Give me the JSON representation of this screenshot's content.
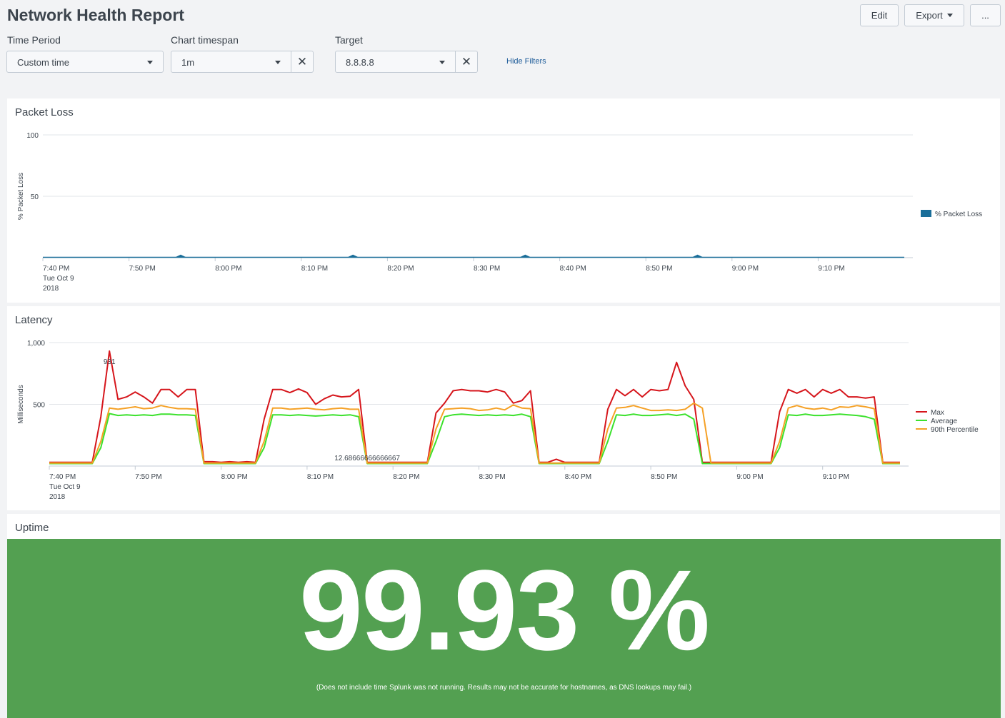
{
  "header": {
    "title": "Network Health Report",
    "edit_label": "Edit",
    "export_label": "Export",
    "more_label": "..."
  },
  "filters": {
    "time_period": {
      "label": "Time Period",
      "value": "Custom time"
    },
    "chart_timespan": {
      "label": "Chart timespan",
      "value": "1m"
    },
    "target": {
      "label": "Target",
      "value": "8.8.8.8"
    },
    "hide_filters": "Hide Filters",
    "clear_icon": "close-icon"
  },
  "panels": {
    "packet_loss": {
      "title": "Packet Loss",
      "chart_data": {
        "type": "area",
        "ylabel": "% Packet Loss",
        "ylim": [
          0,
          100
        ],
        "y_ticks": [
          "100",
          "50"
        ],
        "x_ticks": [
          "7:40 PM",
          "7:50 PM",
          "8:00 PM",
          "8:10 PM",
          "8:20 PM",
          "8:30 PM",
          "8:40 PM",
          "8:50 PM",
          "9:00 PM",
          "9:10 PM"
        ],
        "x_start_label": [
          "7:40 PM",
          "Tue Oct 9",
          "2018"
        ],
        "legend": [
          {
            "name": "% Packet Loss",
            "color": "#1a6e99"
          }
        ],
        "spike_minutes": [
          16,
          36,
          56,
          76
        ],
        "spike_value": 2.5,
        "x_domain_minutes": [
          0,
          100
        ],
        "baseline_value": 0.3
      }
    },
    "latency": {
      "title": "Latency",
      "chart_data": {
        "type": "line",
        "ylabel": "Milliseconds",
        "ylim": [
          0,
          1000
        ],
        "y_ticks": [
          "1,000",
          "500"
        ],
        "x_ticks": [
          "7:40 PM",
          "7:50 PM",
          "8:00 PM",
          "8:10 PM",
          "8:20 PM",
          "8:30 PM",
          "8:40 PM",
          "8:50 PM",
          "9:00 PM",
          "9:10 PM"
        ],
        "x_start_label": [
          "7:40 PM",
          "Tue Oct 9",
          "2018"
        ],
        "x_minutes": [
          0,
          5,
          6,
          7,
          8,
          9,
          10,
          11,
          12,
          13,
          14,
          15,
          16,
          17,
          18,
          19,
          20,
          21,
          22,
          23,
          24,
          25,
          26,
          27,
          28,
          29,
          30,
          31,
          32,
          33,
          34,
          35,
          36,
          37,
          38,
          39,
          40,
          41,
          42,
          43,
          44,
          45,
          46,
          47,
          48,
          49,
          50,
          51,
          52,
          53,
          54,
          55,
          56,
          57,
          58,
          59,
          60,
          61,
          62,
          63,
          64,
          65,
          66,
          67,
          68,
          69,
          70,
          71,
          72,
          73,
          74,
          75,
          76,
          77,
          78,
          79,
          80,
          81,
          82,
          83,
          84,
          85,
          86,
          87,
          88,
          89,
          90,
          91,
          92,
          93,
          94,
          95,
          96,
          97,
          98,
          99,
          100
        ],
        "annotations": [
          {
            "x_minute": 7,
            "text": "931"
          },
          {
            "x_minute": 37,
            "text": "12.68666666666667"
          }
        ],
        "series": [
          {
            "name": "Max",
            "color": "#d6161c",
            "values": [
              30,
              30,
              400,
              931,
              540,
              560,
              600,
              560,
              510,
              620,
              620,
              560,
              620,
              620,
              35,
              35,
              30,
              35,
              30,
              35,
              30,
              380,
              620,
              620,
              595,
              625,
              595,
              500,
              545,
              575,
              560,
              565,
              620,
              30,
              30,
              30,
              30,
              30,
              30,
              30,
              30,
              430,
              510,
              610,
              620,
              610,
              610,
              600,
              620,
              600,
              510,
              530,
              610,
              30,
              30,
              55,
              30,
              30,
              30,
              30,
              30,
              460,
              620,
              570,
              620,
              560,
              620,
              610,
              620,
              840,
              650,
              540,
              30,
              30,
              30,
              30,
              30,
              30,
              30,
              30,
              30,
              440,
              620,
              590,
              620,
              560,
              620,
              590,
              620,
              560,
              560,
              550,
              560,
              30,
              30,
              30
            ]
          },
          {
            "name": "Average",
            "color": "#3ce12d",
            "values": [
              20,
              20,
              150,
              425,
              410,
              415,
              410,
              415,
              410,
              420,
              420,
              415,
              415,
              410,
              20,
              20,
              20,
              20,
              20,
              20,
              20,
              150,
              415,
              415,
              410,
              415,
              410,
              405,
              410,
              415,
              410,
              415,
              400,
              20,
              20,
              20,
              20,
              20,
              20,
              20,
              20,
              200,
              400,
              415,
              420,
              415,
              410,
              415,
              410,
              415,
              410,
              420,
              400,
              20,
              20,
              20,
              20,
              20,
              20,
              20,
              20,
              200,
              415,
              410,
              420,
              410,
              410,
              415,
              420,
              410,
              420,
              380,
              20,
              20,
              20,
              20,
              20,
              20,
              20,
              20,
              20,
              150,
              415,
              410,
              420,
              410,
              410,
              415,
              420,
              415,
              410,
              400,
              380,
              20,
              20,
              20
            ]
          },
          {
            "name": "90th Percentile",
            "color": "#f5a126",
            "values": [
              25,
              25,
              200,
              470,
              460,
              470,
              480,
              465,
              470,
              490,
              475,
              465,
              465,
              460,
              25,
              25,
              25,
              25,
              25,
              25,
              25,
              200,
              470,
              470,
              460,
              465,
              470,
              460,
              455,
              465,
              470,
              460,
              460,
              25,
              25,
              25,
              25,
              25,
              25,
              25,
              25,
              300,
              460,
              465,
              470,
              465,
              450,
              455,
              470,
              455,
              495,
              470,
              465,
              25,
              25,
              25,
              25,
              25,
              25,
              25,
              25,
              300,
              470,
              475,
              490,
              470,
              450,
              450,
              455,
              450,
              460,
              510,
              470,
              25,
              25,
              25,
              25,
              25,
              25,
              25,
              25,
              200,
              470,
              490,
              470,
              460,
              470,
              455,
              480,
              475,
              490,
              480,
              465,
              25,
              25,
              25
            ]
          }
        ]
      }
    },
    "uptime": {
      "title": "Uptime",
      "value": "99.93 %",
      "bg_color": "#53a051",
      "note": "(Does not include time Splunk was not running. Results may not be accurate for hostnames, as DNS lookups may fail.)"
    }
  }
}
